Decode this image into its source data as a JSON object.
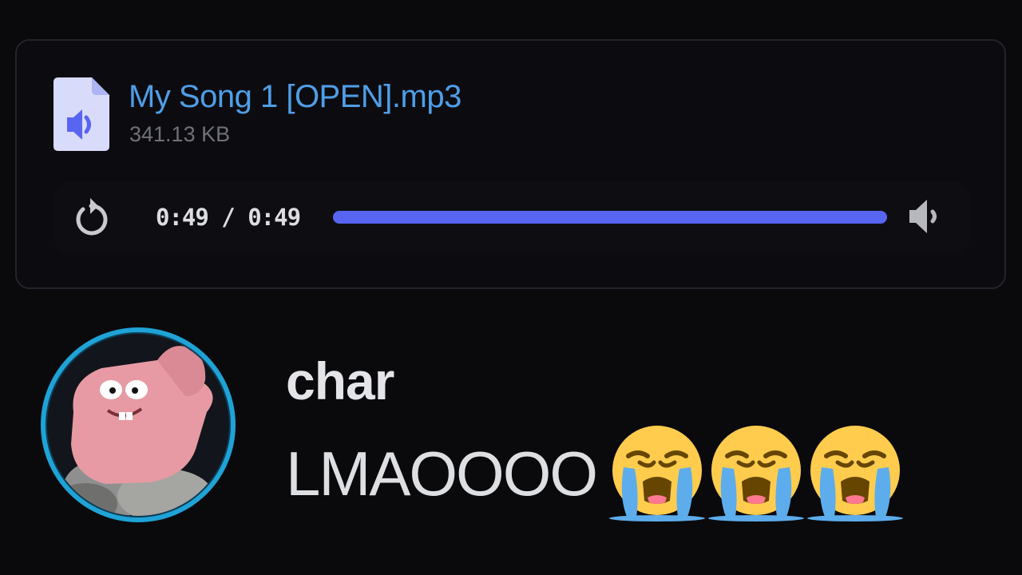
{
  "attachment": {
    "file_name": "My Song 1 [OPEN].mp3",
    "file_size": "341.13 KB",
    "file_icon": "audio-file-icon"
  },
  "player": {
    "time": "0:49 / 0:49",
    "progress": 1.0,
    "replay_icon": "replay-icon",
    "volume_icon": "volume-icon",
    "accent_color": "#5865f2"
  },
  "message": {
    "author": "char",
    "text": "LMAOOOO",
    "emojis": [
      "loudly-crying-face-icon",
      "loudly-crying-face-icon",
      "loudly-crying-face-icon"
    ],
    "avatar_icon": "avatar"
  },
  "colors": {
    "background": "#0a0a0d",
    "link": "#4f9ee8",
    "muted": "#6f7178",
    "avatar_ring": "#1fa3d6"
  }
}
